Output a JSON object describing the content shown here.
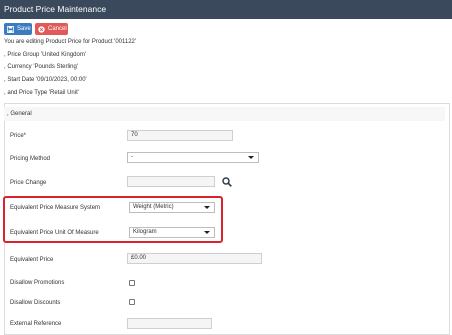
{
  "window": {
    "title": "Product Price Maintenance"
  },
  "toolbar": {
    "save_label": "Save",
    "cancel_label": "Cancel"
  },
  "info": {
    "editing": "You are editing Product Price for Product '001122'",
    "price_group": ", Price Group 'United Kingdom'",
    "currency": ", Currency 'Pounds Sterling'",
    "start_date": ", Start Date '09/10/2023, 00:00'",
    "price_type": ", and Price Type 'Retail Unit'"
  },
  "section": {
    "title": ", General"
  },
  "form": {
    "price_label": "Price*",
    "price_value": "70",
    "pricing_method_label": "Pricing Method",
    "pricing_method_value": "-",
    "price_change_label": "Price Change",
    "price_change_value": "",
    "measure_system_label": "Equivalent Price Measure System",
    "measure_system_value": "Weight (Metric)",
    "unit_of_measure_label": "Equivalent Price Unit Of Measure",
    "unit_of_measure_value": "Kilogram",
    "equivalent_price_label": "Equivalent Price",
    "equivalent_price_value": "£0.00",
    "disallow_promotions_label": "Disallow Promotions",
    "disallow_discounts_label": "Disallow Discounts",
    "external_reference_label": "External Reference",
    "external_reference_value": ""
  },
  "colors": {
    "titlebar": "#3a4a5c",
    "save": "#3b7bc0",
    "cancel": "#e05a5a",
    "highlight": "#d9232d"
  },
  "icons": {
    "save": "floppy-disk-icon",
    "cancel": "cancel-circle-icon",
    "search": "search-icon"
  }
}
